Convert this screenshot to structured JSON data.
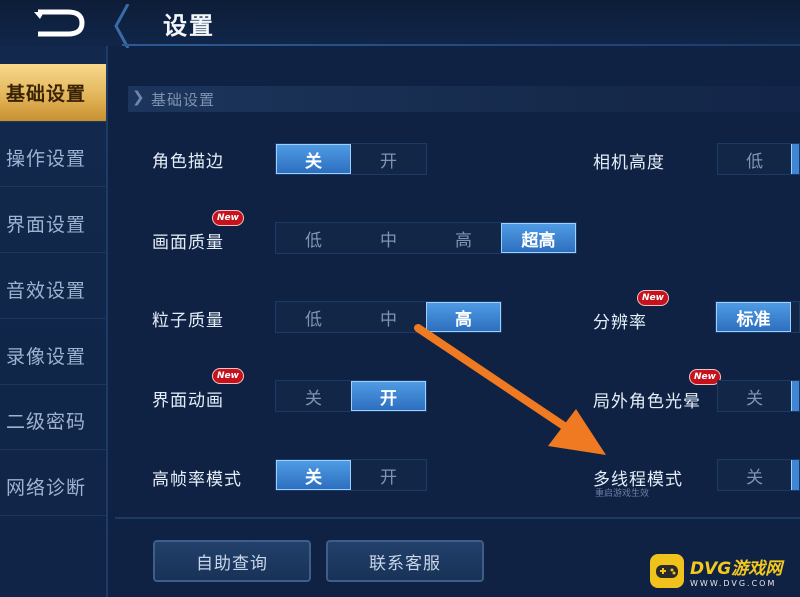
{
  "header": {
    "title": "设置"
  },
  "sidebar": {
    "items": [
      {
        "label": "基础设置",
        "active": true
      },
      {
        "label": "操作设置"
      },
      {
        "label": "界面设置"
      },
      {
        "label": "音效设置"
      },
      {
        "label": "录像设置"
      },
      {
        "label": "二级密码"
      },
      {
        "label": "网络诊断"
      }
    ]
  },
  "section": {
    "title": "基础设置"
  },
  "settings": {
    "outline": {
      "label": "角色描边",
      "options": [
        "关",
        "开"
      ],
      "selected": "关"
    },
    "quality": {
      "label": "画面质量",
      "badge": "New",
      "options": [
        "低",
        "中",
        "高",
        "超高"
      ],
      "selected": "超高"
    },
    "particle": {
      "label": "粒子质量",
      "options": [
        "低",
        "中",
        "高"
      ],
      "selected": "高"
    },
    "ui_anim": {
      "label": "界面动画",
      "badge": "New",
      "options": [
        "关",
        "开"
      ],
      "selected": "开"
    },
    "high_fps": {
      "label": "高帧率模式",
      "options": [
        "关",
        "开"
      ],
      "selected": "关"
    },
    "camera": {
      "label": "相机高度",
      "options": [
        "低"
      ],
      "selected": ""
    },
    "resolution": {
      "label": "分辨率",
      "badge": "New",
      "options": [
        "标准"
      ],
      "selected": "标准"
    },
    "outside_light": {
      "label": "局外角色光晕",
      "badge": "New",
      "options": [
        "关"
      ],
      "selected": ""
    },
    "multithread": {
      "label": "多线程模式",
      "sub": "重启游戏生效",
      "options": [
        "关"
      ],
      "selected": ""
    }
  },
  "buttons": {
    "self_help": "自助查询",
    "contact": "联系客服"
  },
  "watermark": {
    "name": "DVG游戏网",
    "url": "WWW.DVG.COM"
  },
  "colors": {
    "accent_gold": "#e1b256",
    "selected_blue": "#2d6fbf",
    "arrow_orange": "#f07a22",
    "badge_red": "#c7121d"
  }
}
